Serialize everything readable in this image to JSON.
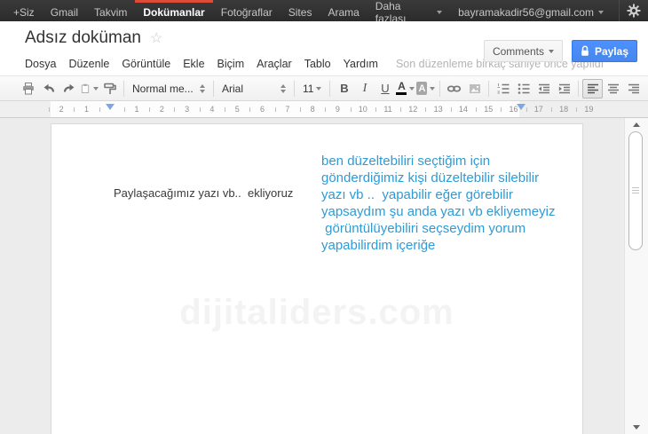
{
  "topbar": {
    "items": [
      "+Siz",
      "Gmail",
      "Takvim",
      "Dokümanlar",
      "Fotoğraflar",
      "Sites",
      "Arama",
      "Daha fazlası"
    ],
    "account_email": "bayramakadir56@gmail.com"
  },
  "header": {
    "doc_title": "Adsız doküman",
    "menu_items": [
      "Dosya",
      "Düzenle",
      "Görüntüle",
      "Ekle",
      "Biçim",
      "Araçlar",
      "Tablo",
      "Yardım"
    ],
    "save_status": "Son düzenleme birkaç saniye önce yapıldı",
    "comments_button": "Comments",
    "share_button": "Paylaş"
  },
  "toolbar": {
    "style_selector": "Normal me...",
    "font_selector": "Arial",
    "font_size_selector": "11",
    "bold_label": "B",
    "italic_label": "I",
    "underline_label": "U",
    "text_color_label": "A",
    "highlight_label": "A"
  },
  "ruler": {
    "cells": [
      "2",
      "1",
      "",
      "1",
      "2",
      "3",
      "4",
      "5",
      "6",
      "7",
      "8",
      "9",
      "10",
      "11",
      "12",
      "13",
      "14",
      "15",
      "16",
      "17",
      "18",
      "19"
    ]
  },
  "document": {
    "paragraph_black": "Paylaşacağımız yazı vb..  ekliyoruz",
    "paragraph_blue_lines": [
      "ben düzeltebiliri seçtiğim için",
      "gönderdiğimiz kişi düzeltebilir silebilir",
      "yazı vb ..  yapabilir eğer görebilir",
      "yapsaydım şu anda yazı vb ekliyemeyiz",
      " görüntülüyebiliri seçseydim yorum",
      "yapabilirdim içeriğe"
    ],
    "watermark": "dijitaliders.com"
  },
  "colors": {
    "active_tab_red": "#dd4b39",
    "share_button_blue": "#4d90fe",
    "doc_text_blue": "#2e9bd6"
  }
}
